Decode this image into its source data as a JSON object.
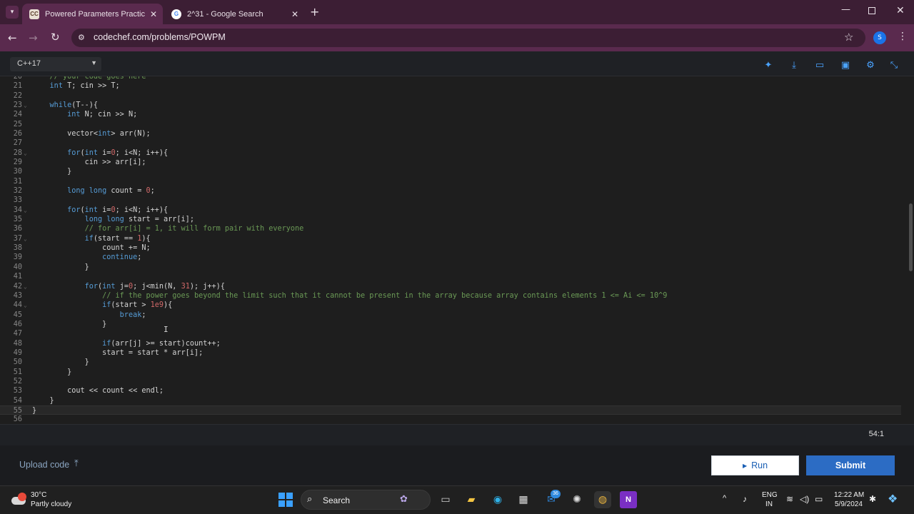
{
  "browser": {
    "tabs": [
      {
        "title": "Powered Parameters Practice C",
        "favicon": "CC"
      },
      {
        "title": "2^31 - Google Search",
        "favicon": "G"
      }
    ],
    "new_tab_glyph": "+",
    "url": "codechef.com/problems/POWPM",
    "profile_initial": "S"
  },
  "editor": {
    "language": "C++17",
    "cursor_position": "54:1",
    "lines": [
      {
        "n": "20",
        "html": "    <span class=\"cm\">// your code goes here</span>"
      },
      {
        "n": "21",
        "html": "    <span class=\"kw\">int</span> T; cin &gt;&gt; T;"
      },
      {
        "n": "22",
        "html": ""
      },
      {
        "n": "23",
        "html": "    <span class=\"kw\">while</span>(T--){",
        "fold": true
      },
      {
        "n": "24",
        "html": "        <span class=\"kw\">int</span> N; cin &gt;&gt; N;"
      },
      {
        "n": "25",
        "html": ""
      },
      {
        "n": "26",
        "html": "        vector&lt;<span class=\"kw\">int</span>&gt; arr(N);"
      },
      {
        "n": "27",
        "html": ""
      },
      {
        "n": "28",
        "html": "        <span class=\"kw\">for</span>(<span class=\"kw\">int</span> i=<span class=\"num\">0</span>; i&lt;N; i++){",
        "fold": true
      },
      {
        "n": "29",
        "html": "            cin &gt;&gt; arr[i];"
      },
      {
        "n": "30",
        "html": "        }"
      },
      {
        "n": "31",
        "html": ""
      },
      {
        "n": "32",
        "html": "        <span class=\"kw\">long long</span> count = <span class=\"num\">0</span>;"
      },
      {
        "n": "33",
        "html": ""
      },
      {
        "n": "34",
        "html": "        <span class=\"kw\">for</span>(<span class=\"kw\">int</span> i=<span class=\"num\">0</span>; i&lt;N; i++){",
        "fold": true
      },
      {
        "n": "35",
        "html": "            <span class=\"kw\">long long</span> start = arr[i];"
      },
      {
        "n": "36",
        "html": "            <span class=\"cm\">// for arr[i] = 1, it will form pair with everyone</span>"
      },
      {
        "n": "37",
        "html": "            <span class=\"kw\">if</span>(start == <span class=\"num\">1</span>){",
        "fold": true
      },
      {
        "n": "38",
        "html": "                count += N;"
      },
      {
        "n": "39",
        "html": "                <span class=\"kw\">continue</span>;"
      },
      {
        "n": "40",
        "html": "            }"
      },
      {
        "n": "41",
        "html": ""
      },
      {
        "n": "42",
        "html": "            <span class=\"kw\">for</span>(<span class=\"kw\">int</span> j=<span class=\"num\">0</span>; j&lt;min(N, <span class=\"num\">31</span>); j++){",
        "fold": true
      },
      {
        "n": "43",
        "html": "                <span class=\"cm\">// if the power goes beyond the limit such that it cannot be present in the array because array contains elements 1 &lt;= Ai &lt;= 10^9</span>"
      },
      {
        "n": "44",
        "html": "                <span class=\"kw\">if</span>(start &gt; <span class=\"num\">1e9</span>){",
        "fold": true
      },
      {
        "n": "45",
        "html": "                    <span class=\"kw\">break</span>;"
      },
      {
        "n": "46",
        "html": "                }"
      },
      {
        "n": "47",
        "html": ""
      },
      {
        "n": "48",
        "html": "                <span class=\"kw\">if</span>(arr[j] &gt;= start)count++;"
      },
      {
        "n": "49",
        "html": "                start = start * arr[i];"
      },
      {
        "n": "50",
        "html": "            }"
      },
      {
        "n": "51",
        "html": "        }"
      },
      {
        "n": "52",
        "html": ""
      },
      {
        "n": "53",
        "html": "        cout &lt;&lt; count &lt;&lt; endl;"
      },
      {
        "n": "54",
        "html": "    }"
      },
      {
        "n": "55",
        "html": "}",
        "current": true
      },
      {
        "n": "56",
        "html": ""
      }
    ]
  },
  "actions": {
    "upload_label": "Upload code",
    "run_label": "Run",
    "submit_label": "Submit"
  },
  "taskbar": {
    "weather_temp": "30°C",
    "weather_desc": "Partly cloudy",
    "search_label": "Search",
    "lang_top": "ENG",
    "lang_bottom": "IN",
    "time": "12:22 AM",
    "date": "5/9/2024",
    "badge_count": "36"
  },
  "colors": {
    "tabbar_bg": "#3c1e34",
    "navbar_bg": "#5a2a4e",
    "editor_bg": "#1e1e1e",
    "keyword": "#569cd6",
    "number": "#d16969",
    "comment": "#6a9955",
    "submit_bg": "#2c6cc4"
  }
}
